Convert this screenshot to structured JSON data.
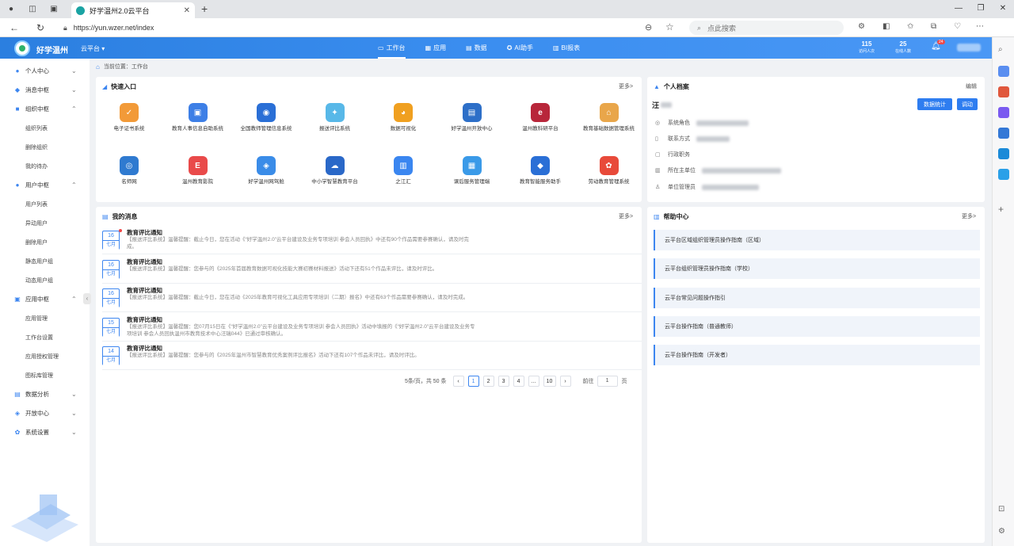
{
  "browser": {
    "tab_title": "好学温州2.0云平台",
    "url": "https://yun.wzer.net/index",
    "search_placeholder": "点此搜索"
  },
  "header": {
    "brand": "好学温州",
    "platform": "云平台",
    "nav": [
      {
        "label": "工作台",
        "icon": "desktop-icon"
      },
      {
        "label": "应用",
        "icon": "apps-icon"
      },
      {
        "label": "数据",
        "icon": "data-icon"
      },
      {
        "label": "AI助手",
        "icon": "ai-icon"
      },
      {
        "label": "BI报表",
        "icon": "report-icon"
      }
    ],
    "stats": [
      {
        "value": "115",
        "label": "访问人次"
      },
      {
        "value": "25",
        "label": "在线人数"
      }
    ],
    "notification_count": "24"
  },
  "sidebar": {
    "menus": [
      {
        "label": "个人中心",
        "icon": "user-icon"
      },
      {
        "label": "消息中枢",
        "icon": "message-icon"
      },
      {
        "label": "组织中枢",
        "icon": "org-icon",
        "children": [
          "组织列表",
          "删除组织",
          "我的待办"
        ]
      },
      {
        "label": "用户中枢",
        "icon": "users-icon",
        "children": [
          "用户列表",
          "异动用户",
          "删除用户",
          "静态用户组",
          "动态用户组"
        ]
      },
      {
        "label": "应用中枢",
        "icon": "app-center-icon",
        "children": [
          "应用管理",
          "工作台设置",
          "应用授权管理",
          "图标库管理"
        ]
      },
      {
        "label": "数据分析",
        "icon": "chart-icon"
      },
      {
        "label": "开放中心",
        "icon": "open-icon"
      },
      {
        "label": "系统设置",
        "icon": "settings-icon"
      }
    ]
  },
  "breadcrumb": {
    "prefix": "当前位置：",
    "current": "工作台"
  },
  "quick": {
    "title": "快速入口",
    "more": "更多>",
    "apps": [
      {
        "label": "电子证书系统",
        "color": "#f29a38"
      },
      {
        "label": "教育人事信息自助系统",
        "color": "#3d7fe6"
      },
      {
        "label": "全国教师管理信息系统",
        "color": "#2a6fd6"
      },
      {
        "label": "报送评比系统",
        "color": "#58b8e8"
      },
      {
        "label": "数据可视化",
        "color": "#f0a020"
      },
      {
        "label": "好学温州开放中心",
        "color": "#2d6fc8"
      },
      {
        "label": "温州教科研平台",
        "color": "#b8263a"
      },
      {
        "label": "教育基础数据管理系统",
        "color": "#e9a64a"
      },
      {
        "label": "名师网",
        "color": "#2f7ad0"
      },
      {
        "label": "温州教育影院",
        "color": "#e94a4a"
      },
      {
        "label": "好学温州网驾舱",
        "color": "#3a8ce8"
      },
      {
        "label": "中小学智慧教育平台",
        "color": "#2a68c8"
      },
      {
        "label": "之江汇",
        "color": "#3a86f0"
      },
      {
        "label": "课后服务管理端",
        "color": "#3a9ae8"
      },
      {
        "label": "教育智能服务助手",
        "color": "#2a6fd6"
      },
      {
        "label": "劳动教育管理系统",
        "color": "#e84a3a"
      }
    ]
  },
  "messages": {
    "title": "我的消息",
    "more": "更多>",
    "items": [
      {
        "day": "16",
        "month": "七月",
        "title": "教育评比通知",
        "content": "【报送评比系统】温馨提醒：截止今日，您在活动《“好学温州2.0”云平台建设及业务专项培训 参会人员回执》中还有90个作品需要参赛确认，请及时完成。"
      },
      {
        "day": "16",
        "month": "七月",
        "title": "教育评比通知",
        "content": "【报送评比系统】温馨提醒：您参与的《2025年首届教育数据可视化技能大赛初赛材料报送》活动下还有51个作品未评比，请及时评比。"
      },
      {
        "day": "16",
        "month": "七月",
        "title": "教育评比通知",
        "content": "【报送评比系统】温馨提醒：截止今日，您在活动《2025年教育可视化工具应用专项培训（二期）报名》中还有63个作品需要参赛确认，请及时完成。"
      },
      {
        "day": "15",
        "month": "七月",
        "title": "教育评比通知",
        "content": "【报送评比系统】温馨提醒：您07月15日在《“好学温州2.0”云平台建设及业务专项培训 参会人员回执》活动中填报的《“好学温州2.0”云平台建设及业务专项培训 参会人员回执温州市教育技术中心汪瑞044》已通过审核确认。"
      },
      {
        "day": "14",
        "month": "七月",
        "title": "教育评比通知",
        "content": "【报送评比系统】温馨提醒：您参与的《2025年温州市智慧教育优秀案例评比报名》活动下还有107个作品未评比，请及时评比。"
      }
    ],
    "pager": {
      "total": "5条/页，共 50 条",
      "pages": [
        "1",
        "2",
        "3",
        "4",
        "…",
        "10"
      ],
      "current": "1",
      "goto": "前往",
      "goto_value": "1",
      "page_unit": "页"
    }
  },
  "profile": {
    "title": "个人档案",
    "edit": "编辑",
    "name": "汪",
    "buttons": [
      "数据统计",
      "调动"
    ],
    "fields": [
      {
        "label": "系统角色",
        "icon": "role-icon"
      },
      {
        "label": "联系方式",
        "icon": "phone-icon"
      },
      {
        "label": "行政职务",
        "icon": "post-icon"
      },
      {
        "label": "所在主单位",
        "icon": "building-icon"
      },
      {
        "label": "单位管理员",
        "icon": "admin-icon"
      }
    ]
  },
  "help": {
    "title": "帮助中心",
    "more": "更多>",
    "items": [
      "云平台区域组织管理员操作指南（区域）",
      "云平台组织管理员操作指南（学校）",
      "云平台常见问题操作指引",
      "云平台操作指南（普通教师）",
      "云平台操作指南（开发者）"
    ]
  }
}
